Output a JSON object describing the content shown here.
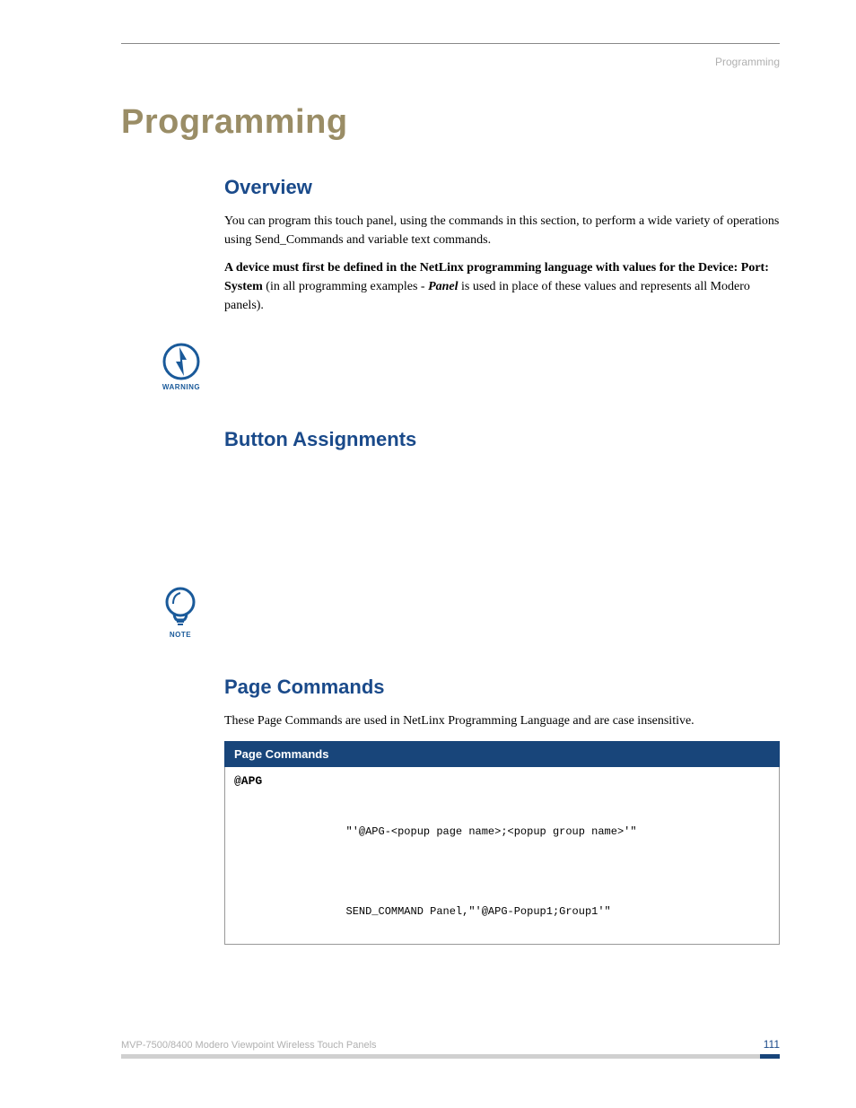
{
  "header": {
    "running_head": "Programming"
  },
  "title": "Programming",
  "sections": {
    "overview": {
      "heading": "Overview",
      "p1": "You can program this touch panel, using the commands in this section, to perform a wide variety of operations using Send_Commands and variable text commands.",
      "p2_bold": "A device must first be defined in the NetLinx programming language with values for the Device: Port: System",
      "p2_mid": " (in all programming examples - ",
      "p2_italic": "Panel",
      "p2_end": " is used in place of these values and represents all Modero panels)."
    },
    "button_assignments": {
      "heading": "Button Assignments"
    },
    "page_commands": {
      "heading": "Page Commands",
      "intro": "These Page Commands are used in NetLinx Programming Language and are case insensitive.",
      "table": {
        "header": "Page Commands",
        "row1": {
          "name": "@APG",
          "syntax": "\"'@APG-<popup page name>;<popup group name>'\"",
          "example": "SEND_COMMAND Panel,\"'@APG-Popup1;Group1'\""
        }
      }
    }
  },
  "icons": {
    "warning_label": "WARNING",
    "note_label": "NOTE"
  },
  "footer": {
    "product": "MVP-7500/8400 Modero Viewpoint Wireless Touch Panels",
    "page": "111"
  }
}
